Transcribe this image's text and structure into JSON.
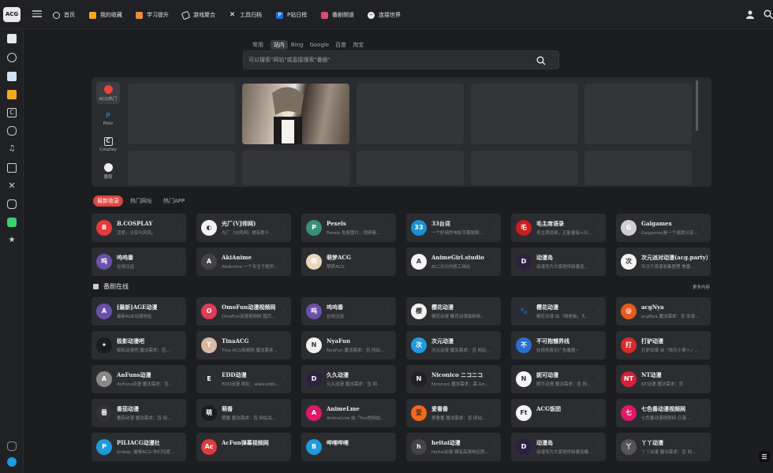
{
  "logo": "ACG",
  "nav": [
    {
      "label": "首页",
      "icon": "home-icon"
    },
    {
      "label": "我的收藏",
      "icon": "bookmark-icon"
    },
    {
      "label": "学习提升",
      "icon": "study-icon"
    },
    {
      "label": "游戏聚合",
      "icon": "gamepad-icon"
    },
    {
      "label": "工具归档",
      "icon": "tools-icon"
    },
    {
      "label": "P站日榜",
      "icon": "pixiv-icon"
    },
    {
      "label": "番剧频道",
      "icon": "anime-icon"
    },
    {
      "label": "连接世界",
      "icon": "globe-icon"
    }
  ],
  "search": {
    "tabs": [
      "常用",
      "站内",
      "Bing",
      "Google",
      "百度",
      "淘宝"
    ],
    "active": "站内",
    "placeholder": "可以搜索\"网站\"或直接搜索\"番剧\""
  },
  "showcase": {
    "categories": [
      {
        "label": "ACG热门",
        "icon": "fire-icon"
      },
      {
        "label": "Pixiv",
        "icon": "pixiv-icon"
      },
      {
        "label": "Cosplay",
        "icon": "cosplay-icon"
      },
      {
        "label": "番剧",
        "icon": "anime-icon"
      }
    ]
  },
  "recent_tabs": [
    "最新收录",
    "热门网址",
    "热门APP"
  ],
  "recent_rows": [
    [
      {
        "name": "B.COSPLAY",
        "desc": "涩爱，分享与风风。",
        "color": "#e23b3b",
        "glyph": "B"
      },
      {
        "name": "光厂(VJ师网)",
        "desc": "光厂（VJ师网）拥有数千...",
        "color": "#f2f2f2",
        "glyph": "◐"
      },
      {
        "name": "Pexels",
        "desc": "Pexels 免费图片，视频素...",
        "color": "#3a8f7a",
        "glyph": "P"
      },
      {
        "name": "33台词",
        "desc": "一个好用的电影字幕搜索...",
        "color": "#1e90d0",
        "glyph": "33"
      },
      {
        "name": "毛主席语录",
        "desc": "毛主席语录，正能量每+日...",
        "color": "#c81e1e",
        "glyph": "毛"
      },
      {
        "name": "Galgamex",
        "desc": "Galgamex是一个成款分享...",
        "color": "#cfcfcf",
        "glyph": "G"
      }
    ],
    [
      {
        "name": "呜呜番",
        "desc": "在线注追",
        "color": "#6b4fa8",
        "glyph": "呜"
      },
      {
        "name": "AkiAnime",
        "desc": "AkiAnime 一个专注于提供...",
        "color": "#444",
        "glyph": "A"
      },
      {
        "name": "萌梦ACG",
        "desc": "萌梦ACG",
        "color": "#e8d8b8",
        "glyph": "萌"
      },
      {
        "name": "AnimeGirl.studio",
        "desc": "AI二次元内容工具站",
        "color": "#f5f5f5",
        "glyph": "A"
      },
      {
        "name": "动漫岛",
        "desc": "动漫岛为大家提供新番连...",
        "color": "#2d2040",
        "glyph": "D"
      },
      {
        "name": "次元派对动漫(acg.party)",
        "desc": "专注于资源收集整理 美番...",
        "color": "#f5f5f5",
        "glyph": "次"
      }
    ]
  ],
  "section": {
    "title": "番剧在线",
    "more": "更多内容"
  },
  "anime_rows": [
    [
      {
        "name": "[最新]AGE动漫",
        "desc": "最新AGE动漫地址",
        "color": "#6b4fa8",
        "glyph": "A"
      },
      {
        "name": "OmoFun动漫视频网",
        "desc": "OmoFun动漫视频网 国页...",
        "color": "#e23b55",
        "glyph": "O"
      },
      {
        "name": "呜呜番",
        "desc": "在线注追",
        "color": "#6b4fa8",
        "glyph": "呜"
      },
      {
        "name": "樱花动漫",
        "desc": "樱花动漫 樱花动漫最新网...",
        "color": "#f2f2f2",
        "glyph": "樱"
      },
      {
        "name": "樱花动漫",
        "desc": "樱花动漫 由「网老板」大...",
        "color": "#2b2d31",
        "glyph": "🐾"
      },
      {
        "name": "acgNya",
        "desc": "acgNya 魔法需求：否 安卓...",
        "color": "#e85a1a",
        "glyph": "@"
      }
    ],
    [
      {
        "name": "极影动漫吧",
        "desc": "极影动漫吧 魔法需求：否...",
        "color": "#1a1c20",
        "glyph": "✦"
      },
      {
        "name": "TinaACG",
        "desc": "Tina ACG视频网 魔法需求...",
        "color": "#d8b8a0",
        "glyph": "T"
      },
      {
        "name": "NyaFun",
        "desc": "NyaFun 魔法需求：否 网站...",
        "color": "#f0f0f0",
        "glyph": "N"
      },
      {
        "name": "次元动漫",
        "desc": "次元动漫 魔法需求：否 网站...",
        "color": "#1e9be0",
        "glyph": "次"
      },
      {
        "name": "不可抱憾界线",
        "desc": "在线免费无广告番剧~",
        "color": "#2a6fd0",
        "glyph": "不"
      },
      {
        "name": "打驴动漫",
        "desc": "打驴动漫 由「快乐小萝卜」...",
        "color": "#d82a2a",
        "glyph": "打"
      }
    ],
    [
      {
        "name": "AnFuns动漫",
        "desc": "AnFuns动漫 魔法需求：否...",
        "color": "#888",
        "glyph": "A"
      },
      {
        "name": "EDD动漫",
        "desc": "EDD动漫 网址：www.eddi...",
        "color": "#2b2d31",
        "glyph": "E"
      },
      {
        "name": "久久动漫",
        "desc": "久久动漫 魔法需求：否 网...",
        "color": "#2d2040",
        "glyph": "D"
      },
      {
        "name": "Niconico ニコニコ",
        "desc": "Niconico 魔法需求：需 &n...",
        "color": "#222",
        "glyph": "N"
      },
      {
        "name": "妮可动漫",
        "desc": "妮可动漫 魔法需求：否 网...",
        "color": "#f5f5f5",
        "glyph": "N"
      },
      {
        "name": "NT动漫",
        "desc": "NT动漫 魔法需求：否",
        "color": "#d81e3a",
        "glyph": "NT"
      }
    ],
    [
      {
        "name": "番茄动漫",
        "desc": "番茄动漫 魔法需求：否 网...",
        "color": "#333",
        "glyph": "番"
      },
      {
        "name": "萌番",
        "desc": "萌番 魔法需求：否 网站关...",
        "color": "#1a1c20",
        "glyph": "萌"
      },
      {
        "name": "AnimeLme",
        "desc": "AnimeLme 由「Yun的网站...",
        "color": "#e0186a",
        "glyph": "A"
      },
      {
        "name": "爱看番",
        "desc": "爱看番 魔法需求：否 网站...",
        "color": "#f26a1a",
        "glyph": "爱"
      },
      {
        "name": "ACG饭团",
        "desc": "",
        "color": "#f5f5f5",
        "glyph": "Ft"
      },
      {
        "name": "七色番动漫视频网",
        "desc": "七色番动漫视频网 日漫...",
        "color": "#e0186a",
        "glyph": "七"
      }
    ],
    [
      {
        "name": "PILIACG动漫社",
        "desc": "&nbsp; 露哥ACG-你们可爱...",
        "color": "#1e9be0",
        "glyph": "P"
      },
      {
        "name": "AcFun弹幕视频网",
        "desc": "",
        "color": "#e23b3b",
        "glyph": "Ac"
      },
      {
        "name": "哔哩哔哩",
        "desc": "",
        "color": "#1e9be0",
        "glyph": "B"
      },
      {
        "name": "heitai动漫",
        "desc": "Heitai动漫 拥有高清响应西...",
        "color": "#444",
        "glyph": "h"
      },
      {
        "name": "动漫岛",
        "desc": "动漫岛为大家提供新番连载...",
        "color": "#2d2040",
        "glyph": "D"
      },
      {
        "name": "丫丫动漫",
        "desc": "丫丫动漫 魔法需求：否 网...",
        "color": "#555",
        "glyph": "丫"
      }
    ]
  ]
}
